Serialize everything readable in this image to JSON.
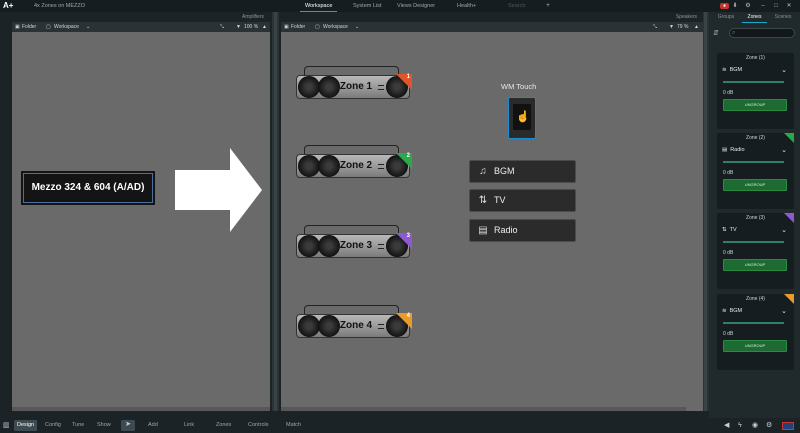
{
  "app": {
    "logo": "A+",
    "document_title": "4x Zones on MEZZO"
  },
  "top_tabs": [
    {
      "label": "Workspace",
      "active": true
    },
    {
      "label": "System List",
      "active": false
    },
    {
      "label": "Views Designer",
      "active": false
    },
    {
      "label": "Health+",
      "active": false
    },
    {
      "label": "Search",
      "active": false
    }
  ],
  "left_panel": {
    "caption": "Amplifiers",
    "folder_label": "Folder",
    "workspace_label": "Workspace",
    "zoom": "100 %",
    "device_label": "Mezzo 324 & 604 (A/AD)"
  },
  "right_panel": {
    "caption": "Speakers",
    "folder_label": "Folder",
    "workspace_label": "Workspace",
    "zoom": "79 %",
    "zones": [
      {
        "name": "Zone 1",
        "number": "1",
        "color": "#e2542a"
      },
      {
        "name": "Zone 2",
        "number": "2",
        "color": "#2aa84a"
      },
      {
        "name": "Zone 3",
        "number": "3",
        "color": "#8e5ad1"
      },
      {
        "name": "Zone 4",
        "number": "4",
        "color": "#e89a2a"
      }
    ],
    "wm_touch_label": "WM Touch",
    "sources": [
      {
        "label": "BGM",
        "icon": "waveform-icon"
      },
      {
        "label": "TV",
        "icon": "tv-audio-icon"
      },
      {
        "label": "Radio",
        "icon": "radio-icon"
      }
    ]
  },
  "sidebar": {
    "tabs": [
      {
        "label": "Groups",
        "active": false
      },
      {
        "label": "Zones",
        "active": true
      },
      {
        "label": "Scenes",
        "active": false
      }
    ],
    "search_placeholder": "",
    "zones": [
      {
        "title": "Zone (1)",
        "source": "BGM",
        "level": "0 dB",
        "button": "UNGROUP",
        "color": "#e2542a"
      },
      {
        "title": "Zone (2)",
        "source": "Radio",
        "level": "0 dB",
        "button": "UNGROUP",
        "color": "#2aa84a"
      },
      {
        "title": "Zone (3)",
        "source": "TV",
        "level": "0 dB",
        "button": "UNGROUP",
        "color": "#8e5ad1"
      },
      {
        "title": "Zone (4)",
        "source": "BGM",
        "level": "0 dB",
        "button": "UNGROUP",
        "color": "#e89a2a"
      }
    ]
  },
  "bottom_bar": {
    "modes": [
      {
        "label": "Design",
        "active": true
      },
      {
        "label": "Config",
        "active": false
      },
      {
        "label": "Tune",
        "active": false
      },
      {
        "label": "Show",
        "active": false
      }
    ],
    "tools": [
      "Add",
      "Link",
      "Zones",
      "Controls",
      "Match"
    ]
  }
}
